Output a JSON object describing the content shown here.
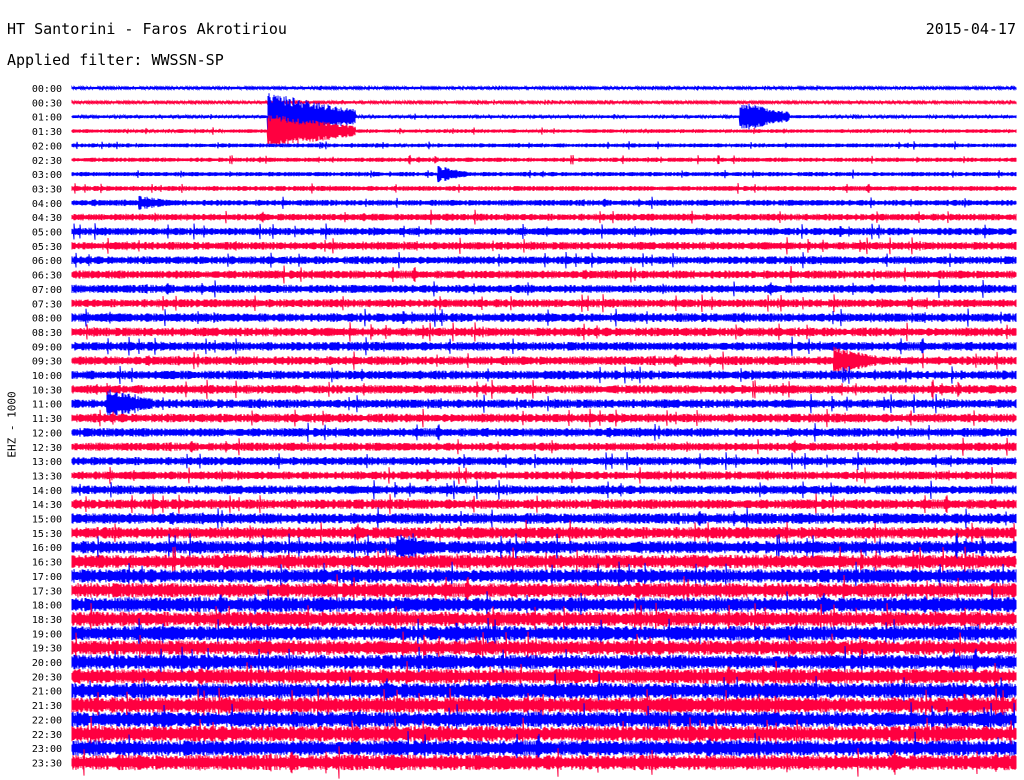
{
  "header": {
    "station": "HT Santorini - Faros Akrotiriou",
    "date": "2015-04-17",
    "filter": "Applied filter: WWSSN-SP"
  },
  "chart_data": {
    "type": "line",
    "title": "HT Santorini - Faros Akrotiriou",
    "ylabel": "EHZ - 1000",
    "xlabel": "",
    "minutes_per_row": 30,
    "colors": [
      "#0000ff",
      "#ff0040"
    ],
    "row_labels": [
      "00:00",
      "00:30",
      "01:00",
      "01:30",
      "02:00",
      "02:30",
      "03:00",
      "03:30",
      "04:00",
      "04:30",
      "05:00",
      "05:30",
      "06:00",
      "06:30",
      "07:00",
      "07:30",
      "08:00",
      "08:30",
      "09:00",
      "09:30",
      "10:00",
      "10:30",
      "11:00",
      "11:30",
      "12:00",
      "12:30",
      "13:00",
      "13:30",
      "14:00",
      "14:30",
      "15:00",
      "15:30",
      "16:00",
      "16:30",
      "17:00",
      "17:30",
      "18:00",
      "18:30",
      "19:00",
      "19:30",
      "20:00",
      "20:30",
      "21:00",
      "21:30",
      "22:00",
      "22:30",
      "23:00",
      "23:30"
    ],
    "noise_level": [
      0.12,
      0.12,
      0.15,
      0.18,
      0.2,
      0.22,
      0.22,
      0.25,
      0.3,
      0.35,
      0.38,
      0.4,
      0.4,
      0.42,
      0.42,
      0.42,
      0.45,
      0.45,
      0.45,
      0.45,
      0.45,
      0.45,
      0.45,
      0.45,
      0.45,
      0.42,
      0.42,
      0.42,
      0.45,
      0.5,
      0.55,
      0.6,
      0.65,
      0.7,
      0.7,
      0.75,
      0.75,
      0.75,
      0.75,
      0.75,
      0.75,
      0.75,
      0.8,
      0.8,
      0.8,
      0.8,
      0.8,
      0.8
    ],
    "events": [
      {
        "row": 2,
        "start_min": 6.2,
        "end_min": 9.0,
        "amplitude": 3.5
      },
      {
        "row": 3,
        "start_min": 6.2,
        "end_min": 9.0,
        "amplitude": 2.5
      },
      {
        "row": 2,
        "start_min": 21.2,
        "end_min": 22.8,
        "amplitude": 2.2
      },
      {
        "row": 6,
        "start_min": 11.6,
        "end_min": 12.6,
        "amplitude": 1.2
      },
      {
        "row": 8,
        "start_min": 2.1,
        "end_min": 3.2,
        "amplitude": 1.1
      },
      {
        "row": 19,
        "start_min": 24.2,
        "end_min": 25.7,
        "amplitude": 2.0
      },
      {
        "row": 22,
        "start_min": 1.1,
        "end_min": 2.6,
        "amplitude": 2.2
      },
      {
        "row": 32,
        "start_min": 10.3,
        "end_min": 11.8,
        "amplitude": 2.0
      },
      {
        "row": 33,
        "start_min": 4.8,
        "end_min": 6.0,
        "amplitude": 1.3
      }
    ]
  }
}
